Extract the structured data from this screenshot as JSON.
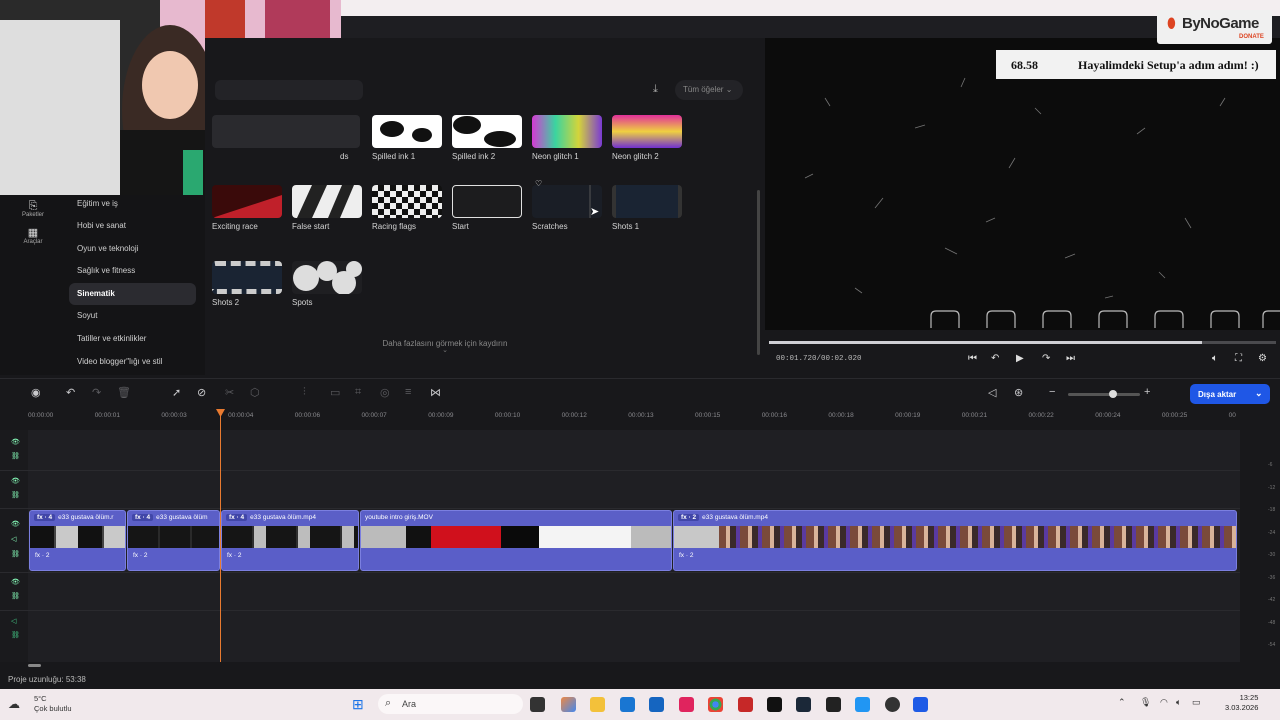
{
  "overlay": {
    "number": "68.58",
    "message": "Hayalimdeki Setup'a adım adım! :)"
  },
  "bynogame": {
    "name": "ByNoGame",
    "donate": "DONATE"
  },
  "sidebar": {
    "tools": [
      {
        "label": "Paketler"
      },
      {
        "label": "Araçlar"
      }
    ],
    "categories": [
      {
        "label": "Eğitim ve iş"
      },
      {
        "label": "Hobi ve sanat"
      },
      {
        "label": "Oyun ve teknoloji"
      },
      {
        "label": "Sağlık ve fitness"
      },
      {
        "label": "Sinematik",
        "active": true
      },
      {
        "label": "Soyut"
      },
      {
        "label": "Tatiller ve etkinlikler"
      },
      {
        "label": "Video blogger\"lığı ve stil"
      }
    ]
  },
  "library": {
    "filter_label": "Tüm öğeler",
    "partial_label": "ds",
    "scroll_hint": "Daha fazlasını görmek için kaydırın",
    "effects": [
      {
        "label": "Spilled ink 1"
      },
      {
        "label": "Spilled ink 2"
      },
      {
        "label": "Neon glitch 1"
      },
      {
        "label": "Neon glitch 2"
      },
      {
        "label": "Exciting race"
      },
      {
        "label": "False start"
      },
      {
        "label": "Racing flags"
      },
      {
        "label": "Start",
        "selected": true
      },
      {
        "label": "Scratches",
        "favorite": true
      },
      {
        "label": "Shots 1"
      },
      {
        "label": "Shots 2"
      },
      {
        "label": "Spots"
      }
    ]
  },
  "preview": {
    "timecode": "00:01.720/00:02.020",
    "progress": 0.855
  },
  "toolbar": {
    "export_label": "Dışa aktar",
    "zoom_level": 0.62
  },
  "timeline": {
    "ruler_ticks": [
      "00:00:00",
      "00:00:01",
      "00:00:03",
      "00:00:04",
      "00:00:06",
      "00:00:07",
      "00:00:09",
      "00:00:10",
      "00:00:12",
      "00:00:13",
      "00:00:15",
      "00:00:16",
      "00:00:18",
      "00:00:19",
      "00:00:21",
      "00:00:22",
      "00:00:24",
      "00:00:25",
      "00"
    ],
    "clips": [
      {
        "fx": "fx · 4",
        "name": "e33 gustava ölüm.r",
        "audio_fx": "fx · 2"
      },
      {
        "fx": "fx · 4",
        "name": "e33 gustava ölüm",
        "audio_fx": "fx · 2"
      },
      {
        "fx": "fx · 4",
        "name": "e33 gustava ölüm.mp4",
        "audio_fx": "fx · 2"
      },
      {
        "fx": "",
        "name": "youtube intro giriş.MOV",
        "audio_fx": ""
      },
      {
        "fx": "fx · 2",
        "name": "e33 gustava ölüm.mp4",
        "audio_fx": "fx · 2"
      }
    ],
    "meter_db": [
      "-6",
      "-12",
      "-18",
      "-24",
      "-30",
      "-36",
      "-42",
      "-48",
      "-54",
      "-60"
    ]
  },
  "status": {
    "project_length": "Proje uzunluğu: 53:38"
  },
  "taskbar": {
    "weather_temp": "5°C",
    "weather_desc": "Çok bulutlu",
    "search_placeholder": "Ara",
    "time": "13:25",
    "date": "3.03.2026"
  }
}
